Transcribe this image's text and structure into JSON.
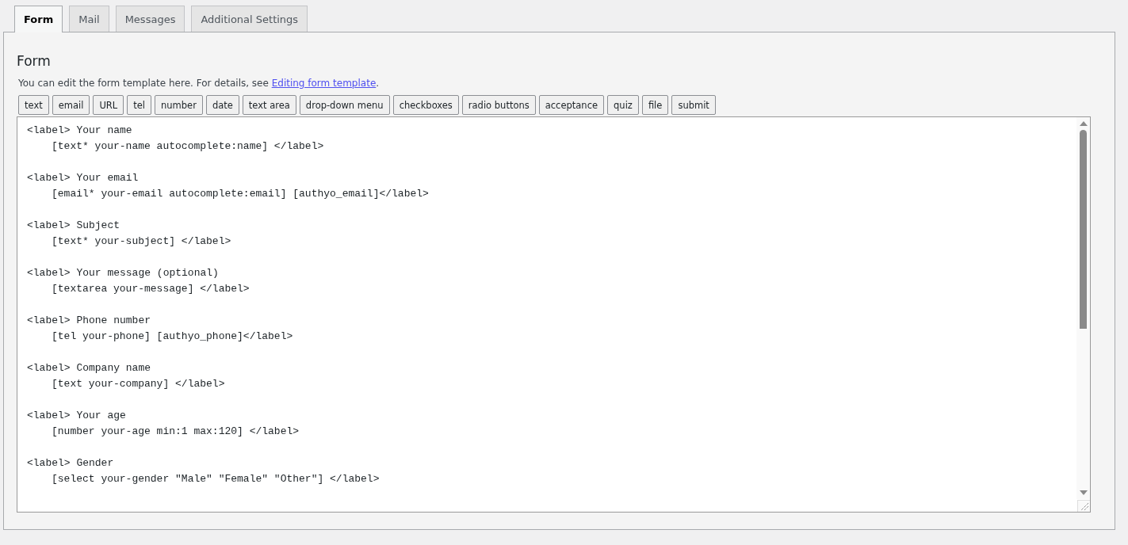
{
  "tabs": [
    {
      "label": "Form",
      "selected": true
    },
    {
      "label": "Mail",
      "selected": false
    },
    {
      "label": "Messages",
      "selected": false
    },
    {
      "label": "Additional Settings",
      "selected": false
    }
  ],
  "panel": {
    "heading": "Form",
    "description": "You can edit the form template here. For details, see ",
    "link": "Editing form template",
    "description_end": "."
  },
  "tag_buttons": [
    "text",
    "email",
    "URL",
    "tel",
    "number",
    "date",
    "text area",
    "drop-down menu",
    "checkboxes",
    "radio buttons",
    "acceptance",
    "quiz",
    "file",
    "submit"
  ],
  "editor": {
    "blocks": [
      {
        "label_line": "<label> Your name",
        "tag_line": "[text* your-name autocomplete:name] </label>"
      },
      {
        "label_line": "<label> Your email",
        "tag_line": "[email* your-email autocomplete:email] [authyo_email]</label>"
      },
      {
        "label_line": "<label> Subject",
        "tag_line": "[text* your-subject] </label>"
      },
      {
        "label_line": "<label> Your message (optional)",
        "tag_line": "[textarea your-message] </label>"
      },
      {
        "label_line": "<label> Phone number",
        "tag_line": "[tel your-phone] [authyo_phone]</label>"
      },
      {
        "label_line": "<label> Company name",
        "tag_line": "[text your-company] </label>"
      },
      {
        "label_line": "<label> Your age",
        "tag_line": "[number your-age min:1 max:120] </label>"
      },
      {
        "label_line": "<label> Gender",
        "tag_line": "[select your-gender \"Male\" \"Female\" \"Other\"] </label>"
      }
    ]
  }
}
